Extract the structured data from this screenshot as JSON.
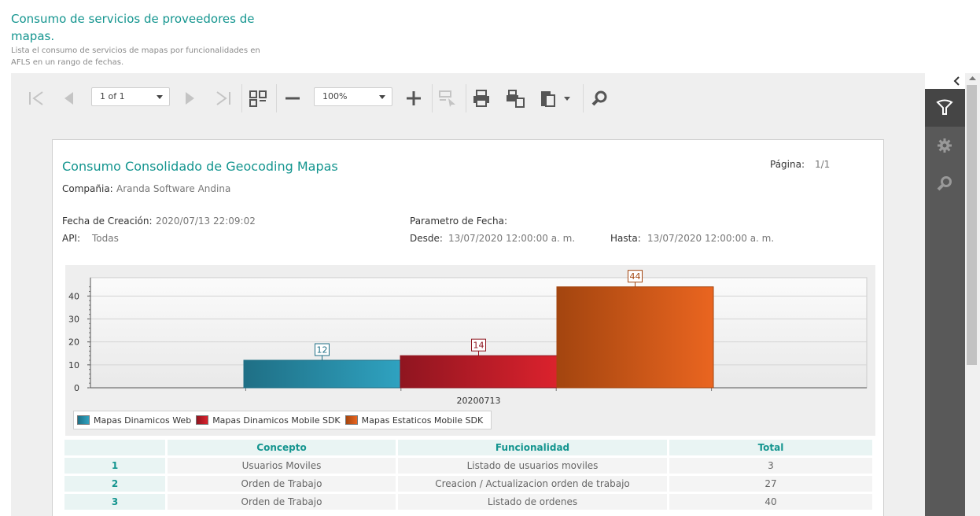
{
  "header": {
    "title": "Consumo de servicios de proveedores de mapas.",
    "description": "Lista el consumo de servicios de mapas por funcionalidades en AFLS en un rango de fechas."
  },
  "toolbar": {
    "page_selector": "1 of 1",
    "zoom_selector": "100%"
  },
  "report": {
    "title": "Consumo Consolidado de Geocoding Mapas",
    "page_label": "Página:",
    "page_value": "1/1",
    "company_label": "Compañia:",
    "company_value": "Aranda Software Andina",
    "created_label": "Fecha de Creación:",
    "created_value": "2020/07/13 22:09:02",
    "api_label": "API:",
    "api_value": "Todas",
    "param_label": "Parametro de Fecha:",
    "from_label": "Desde:",
    "from_value": "13/07/2020 12:00:00 a. m.",
    "to_label": "Hasta:",
    "to_value": "13/07/2020 12:00:00 a. m."
  },
  "chart_data": {
    "type": "bar",
    "categories": [
      "20200713"
    ],
    "series": [
      {
        "name": "Mapas Dinamicos Web",
        "values": [
          12
        ],
        "color": "#2a8aa4"
      },
      {
        "name": "Mapas Dinamicos Mobile SDK",
        "values": [
          14
        ],
        "color": "#b81d26"
      },
      {
        "name": "Mapas Estaticos Mobile SDK",
        "values": [
          44
        ],
        "color": "#d9581b"
      }
    ],
    "yticks": [
      "0",
      "10",
      "20",
      "30",
      "40"
    ],
    "ylim": [
      0,
      48
    ],
    "grid": true,
    "legend_position": "bottom-left"
  },
  "table": {
    "headers": [
      "",
      "Concepto",
      "Funcionalidad",
      "Total"
    ],
    "rows": [
      [
        "1",
        "Usuarios Moviles",
        "Listado de usuarios moviles",
        "3"
      ],
      [
        "2",
        "Orden de Trabajo",
        "Creacion / Actualizacion orden de trabajo",
        "27"
      ],
      [
        "3",
        "Orden de Trabajo",
        "Listado de ordenes",
        "40"
      ]
    ]
  },
  "sidebar": {
    "collapse_icon": "chevron-left-icon",
    "buttons": [
      "filter-icon",
      "gear-icon",
      "search-icon"
    ]
  }
}
